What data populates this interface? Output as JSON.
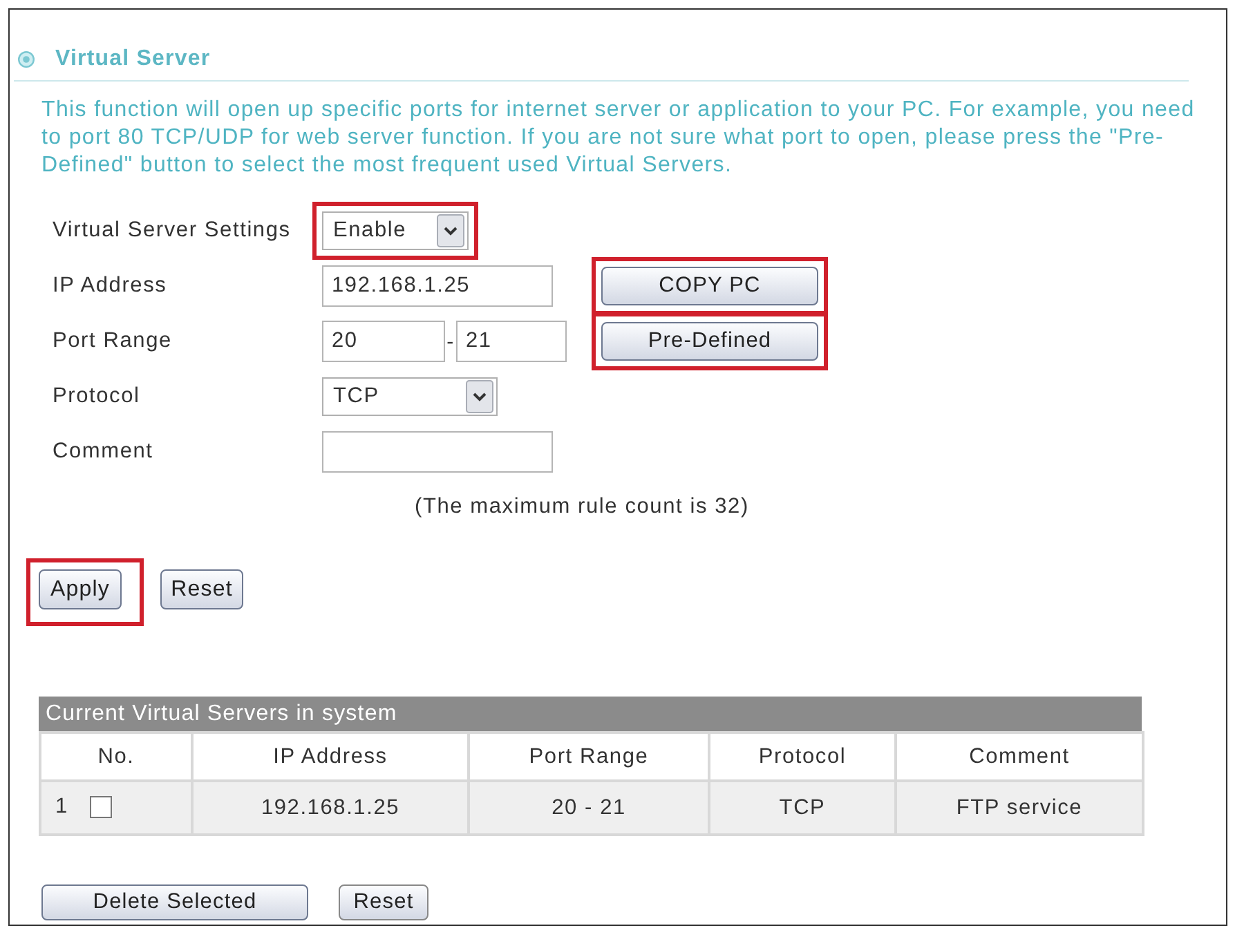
{
  "section": {
    "title": "Virtual Server",
    "description": "This function will open up specific ports for internet server or application to your PC. For example, you need to port 80 TCP/UDP for web server function. If you are not sure what port to open, please press the \"Pre-Defined\" button to select the most frequent used Virtual Servers."
  },
  "form": {
    "rows": [
      {
        "label": "Virtual Server Settings",
        "kind": "select",
        "value": "Enable",
        "highlighted": true
      },
      {
        "label": "IP Address",
        "kind": "text",
        "value": "192.168.1.25",
        "highlighted": false,
        "button": {
          "label": "COPY PC",
          "highlighted": true
        }
      },
      {
        "label": "Port Range",
        "kind": "range",
        "from": "20",
        "separator": "-",
        "to": "21",
        "highlighted": false,
        "button": {
          "label": "Pre-Defined",
          "highlighted": true
        }
      },
      {
        "label": "Protocol",
        "kind": "select",
        "value": "TCP",
        "highlighted": false
      },
      {
        "label": "Comment",
        "kind": "text",
        "highlighted": false
      }
    ],
    "note": "(The maximum rule count is 32)",
    "buttons": [
      {
        "label": "Apply",
        "highlighted": true
      },
      {
        "label": "Reset",
        "highlighted": false
      }
    ]
  },
  "table": {
    "caption": "Current Virtual Servers in system",
    "columns": [
      "No.",
      "IP Address",
      "Port Range",
      "Protocol",
      "Comment"
    ],
    "rows": [
      {
        "no": "1",
        "checked": false,
        "ip_address": "192.168.1.25",
        "port_range": "20 - 21",
        "protocol": "TCP",
        "comment": "FTP service"
      }
    ]
  },
  "table_buttons": [
    "Delete Selected",
    "Reset"
  ]
}
